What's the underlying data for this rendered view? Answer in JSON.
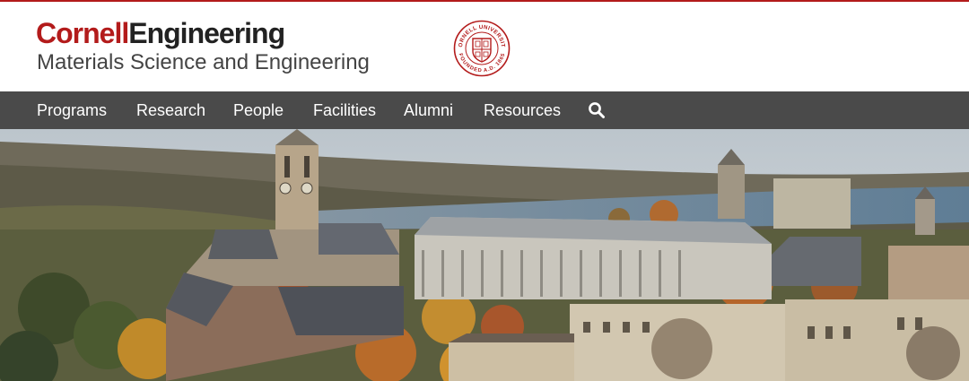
{
  "header": {
    "brand_part1": "Cornell",
    "brand_part2": "Engineering",
    "subtitle": "Materials Science and Engineering",
    "seal": {
      "icon": "cornell-university-seal",
      "text": "CORNELL UNIVERSITY · FOUNDED A.D. 1865"
    }
  },
  "nav": {
    "items": [
      {
        "label": "Programs"
      },
      {
        "label": "Research"
      },
      {
        "label": "People"
      },
      {
        "label": "Facilities"
      },
      {
        "label": "Alumni"
      },
      {
        "label": "Resources"
      }
    ],
    "search_icon": "search-icon"
  },
  "hero": {
    "image": "Cornell campus aerial view with clock tower, lake and autumn trees"
  },
  "colors": {
    "brand_red": "#b31b1b",
    "nav_bg": "#4a4a4a",
    "text_dark": "#222222"
  }
}
